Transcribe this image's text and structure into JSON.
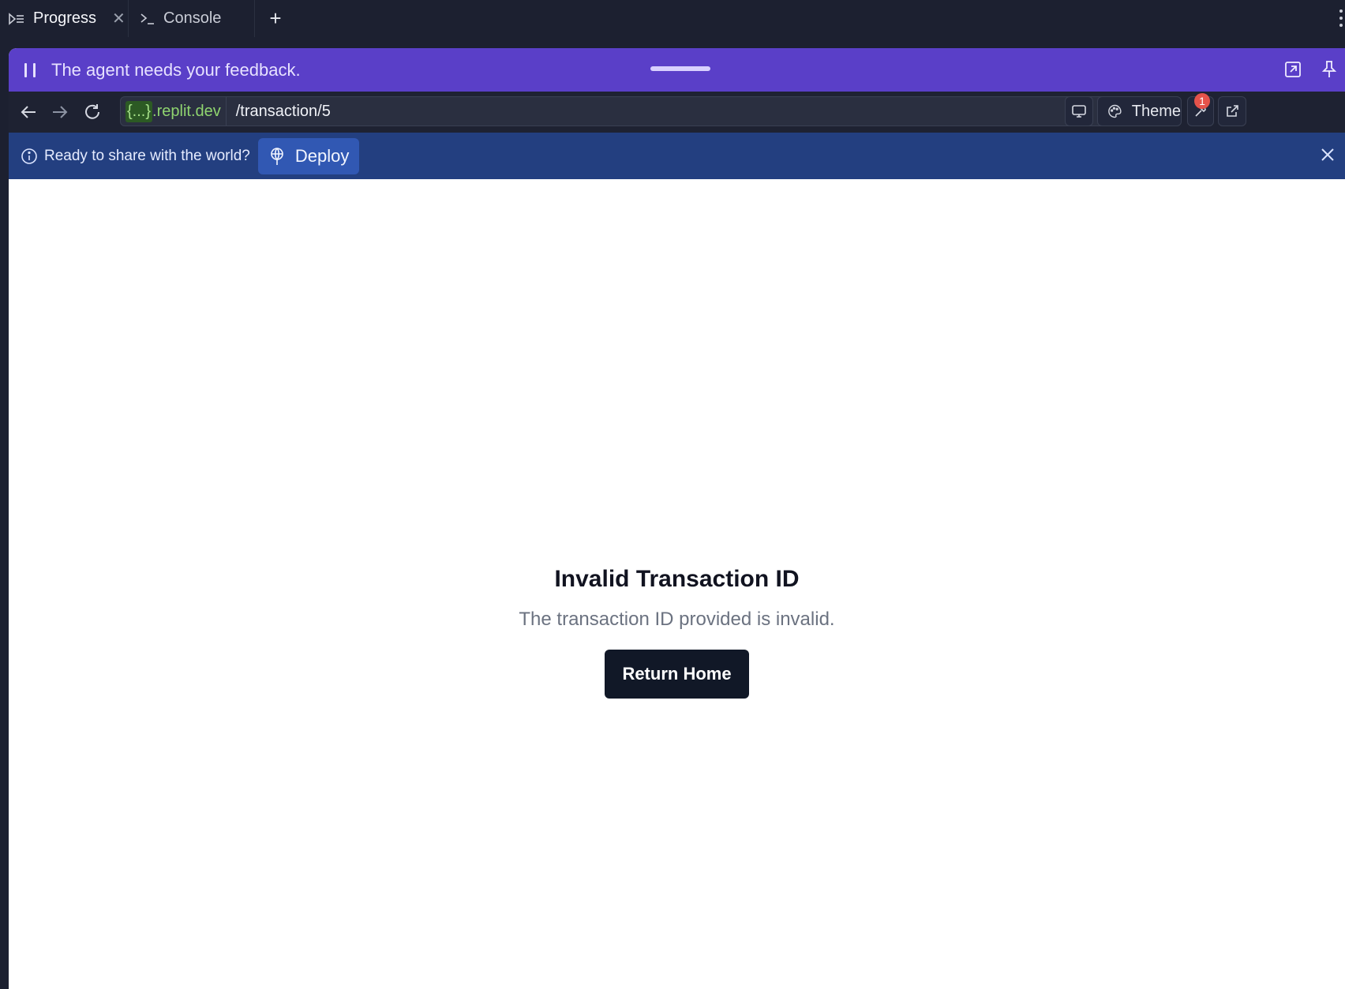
{
  "tabs": [
    {
      "label": "Progress",
      "icon": "progress-icon",
      "active": true
    },
    {
      "label": "Console",
      "icon": "terminal-icon",
      "active": false
    }
  ],
  "feedback_bar": {
    "message": "The agent needs your feedback."
  },
  "urlbar": {
    "host_highlight": "{...}",
    "host_domain": ".replit.dev",
    "path": "/transaction/5",
    "theme_label": "Theme",
    "devtools_badge": "1"
  },
  "deploy_banner": {
    "prompt": "Ready to share with the world?",
    "button_label": "Deploy"
  },
  "page": {
    "heading": "Invalid Transaction ID",
    "message": "The transaction ID provided is invalid.",
    "button_label": "Return Home"
  },
  "colors": {
    "feedback_bar": "#5a3fc8",
    "deploy_banner": "#233f80",
    "primary_button": "#111827"
  }
}
